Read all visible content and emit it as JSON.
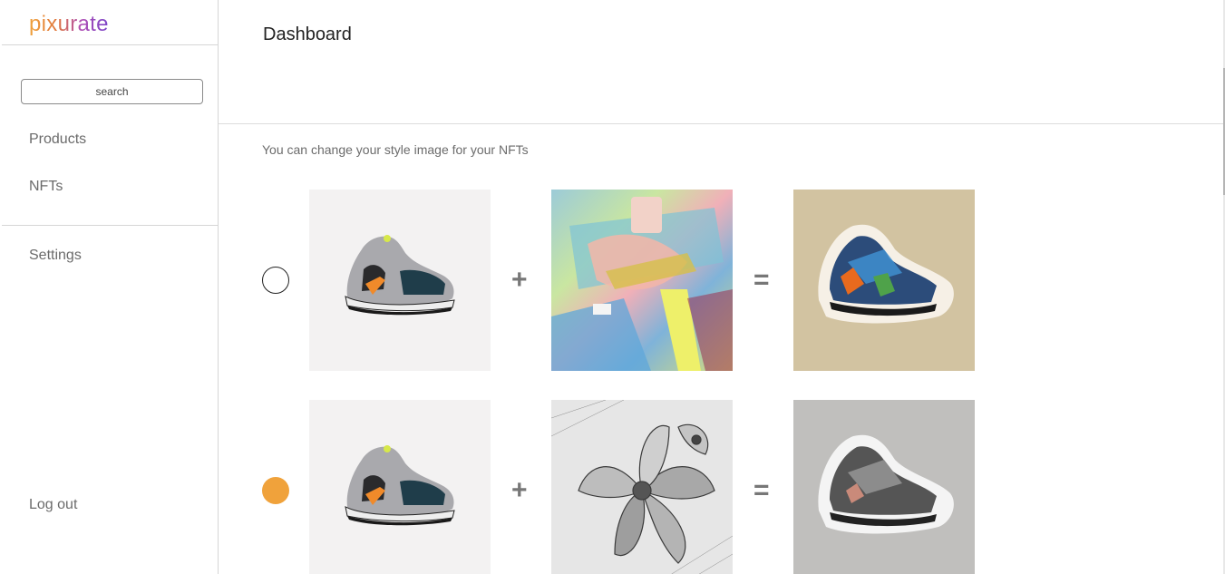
{
  "app": {
    "logo_text": "pixurate",
    "brand_gradient": [
      "#f0a23b",
      "#e0783e",
      "#b04fb5",
      "#7a45c8"
    ]
  },
  "sidebar": {
    "search_placeholder": "search",
    "items": [
      {
        "label": "Products"
      },
      {
        "label": "NFTs"
      },
      {
        "label": "Settings"
      }
    ],
    "logout_label": "Log out"
  },
  "main": {
    "title": "Dashboard",
    "subtitle": "You can change your style image for your NFTs",
    "operators": {
      "plus": "+",
      "equals": "="
    },
    "styles": [
      {
        "selected": false,
        "content_image": "sneaker-photo",
        "style_image": "colorful-painting",
        "result_image": "stylized-sneaker-colorful"
      },
      {
        "selected": true,
        "content_image": "sneaker-photo",
        "style_image": "pencil-sketch-flowers",
        "result_image": "stylized-sneaker-sketch"
      }
    ]
  },
  "colors": {
    "accent_selected": "#f0a23b",
    "text_muted": "#6b6b6b"
  }
}
